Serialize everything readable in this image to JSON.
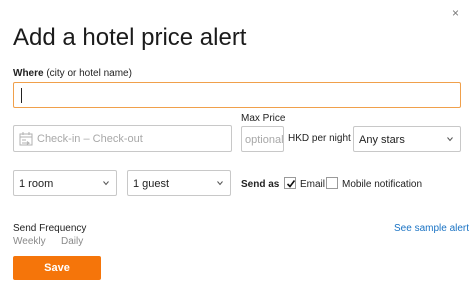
{
  "dialog": {
    "title": "Add a hotel price alert",
    "close_icon": "×"
  },
  "where": {
    "label_bold": "Where",
    "label_hint": "(city or hotel name)",
    "value": ""
  },
  "dates": {
    "placeholder": "Check-in – Check-out",
    "icon": "calendar-icon"
  },
  "max_price": {
    "label": "Max Price",
    "placeholder": "optional",
    "currency": "HKD per night"
  },
  "stars": {
    "selected": "Any stars"
  },
  "rooms": {
    "selected": "1 room"
  },
  "guests": {
    "selected": "1 guest"
  },
  "send_as": {
    "label": "Send as",
    "email_label": "Email",
    "email_checked": true,
    "mobile_label": "Mobile notification",
    "mobile_checked": false
  },
  "frequency": {
    "label": "Send Frequency",
    "options": [
      "Weekly",
      "Daily"
    ]
  },
  "sample_link": "See sample alert",
  "save_label": "Save",
  "colors": {
    "accent": "#f5750a",
    "focus_border": "#f0a04b",
    "link": "#1a73c4"
  }
}
